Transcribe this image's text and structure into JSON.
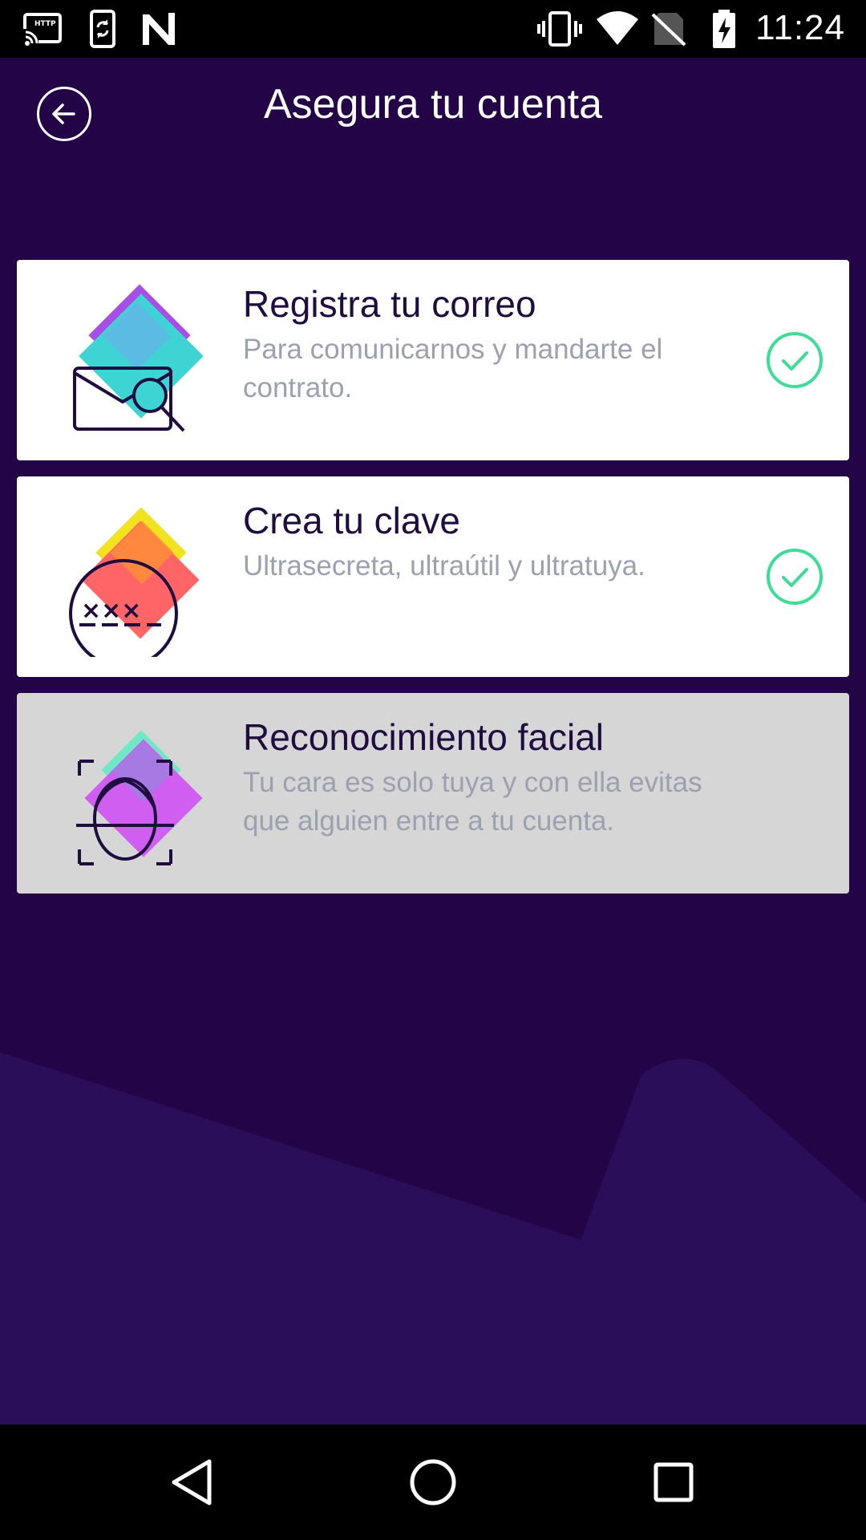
{
  "status_bar": {
    "time": "11:24",
    "left_icons": [
      "cast-http-icon",
      "phone-sync-icon",
      "n-notification-icon"
    ],
    "right_icons": [
      "vibrate-icon",
      "wifi-icon",
      "no-sim-icon",
      "battery-charging-icon"
    ]
  },
  "header": {
    "title": "Asegura tu cuenta",
    "back_icon": "back-arrow-icon"
  },
  "cards": [
    {
      "title": "Registra tu correo",
      "description": "Para comunicarnos y mandarte el contrato.",
      "icon": "email-search-icon",
      "completed": true,
      "disabled": false
    },
    {
      "title": "Crea tu clave",
      "description": "Ultrasecreta, ultraútil y ultratuya.",
      "icon": "password-icon",
      "completed": true,
      "disabled": false
    },
    {
      "title": "Reconocimiento facial",
      "description": "Tu cara es solo tuya y con ella evitas que alguien entre a tu cuenta.",
      "icon": "face-recognition-icon",
      "completed": false,
      "disabled": true
    }
  ],
  "nav_bar": {
    "buttons": [
      "back-triangle-icon",
      "home-circle-icon",
      "recents-square-icon"
    ]
  },
  "colors": {
    "background": "#220447",
    "background_shape": "#2a0e5a",
    "check": "#3ddc97",
    "title_text": "#1f0d3f",
    "description_text": "#9ba1ae",
    "disabled_card": "#d6d6d7"
  }
}
